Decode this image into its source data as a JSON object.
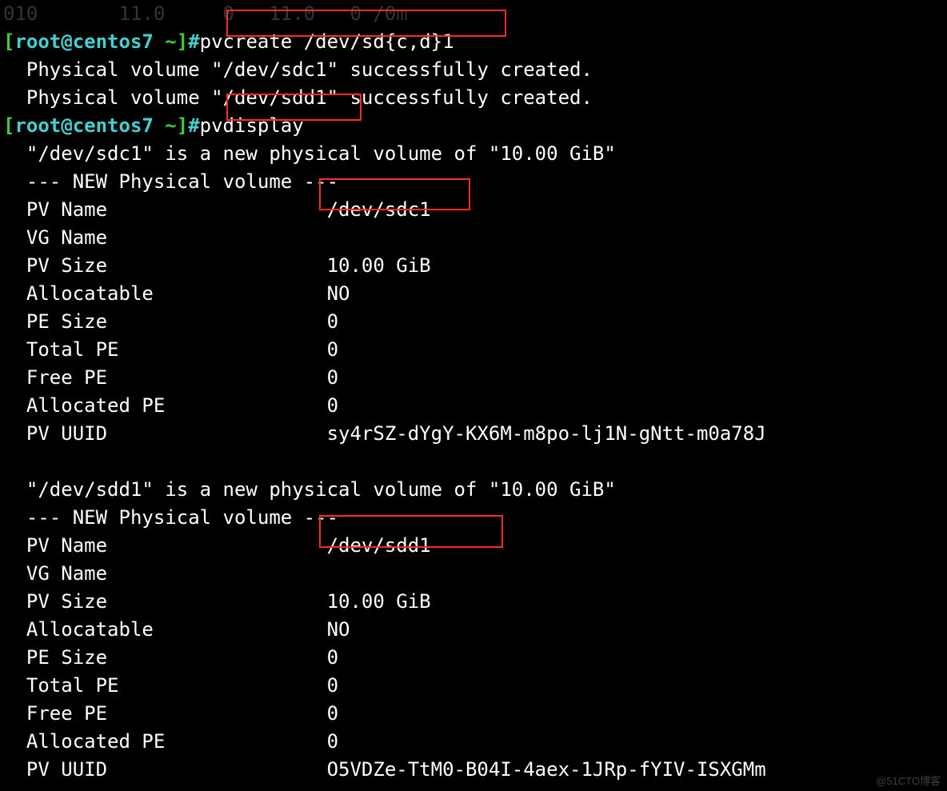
{
  "topCut": "010       11.0     0   11.0   0 /0m",
  "prompt1": {
    "user": "root",
    "host": "centos7",
    "cwd": "~",
    "cmd": "pvcreate /dev/sd{c,d}1"
  },
  "out1a": "  Physical volume \"/dev/sdc1\" successfully created.",
  "out1b": "  Physical volume \"/dev/sdd1\" successfully created.",
  "prompt2": {
    "user": "root",
    "host": "centos7",
    "cwd": "~",
    "cmd": "pvdisplay "
  },
  "pv1": {
    "intro": "  \"/dev/sdc1\" is a new physical volume of \"10.00 GiB\"",
    "hdr": "  --- NEW Physical volume ---",
    "rows": [
      {
        "k": "  PV Name",
        "v": "/dev/sdc1"
      },
      {
        "k": "  VG Name",
        "v": ""
      },
      {
        "k": "  PV Size",
        "v": "10.00 GiB"
      },
      {
        "k": "  Allocatable",
        "v": "NO"
      },
      {
        "k": "  PE Size",
        "v": "0   "
      },
      {
        "k": "  Total PE",
        "v": "0"
      },
      {
        "k": "  Free PE",
        "v": "0"
      },
      {
        "k": "  Allocated PE",
        "v": "0"
      },
      {
        "k": "  PV UUID",
        "v": "sy4rSZ-dYgY-KX6M-m8po-lj1N-gNtt-m0a78J"
      }
    ]
  },
  "blank": "   ",
  "pv2": {
    "intro": "  \"/dev/sdd1\" is a new physical volume of \"10.00 GiB\"",
    "hdr": "  --- NEW Physical volume ---",
    "rows": [
      {
        "k": "  PV Name",
        "v": "/dev/sdd1"
      },
      {
        "k": "  VG Name",
        "v": ""
      },
      {
        "k": "  PV Size",
        "v": "10.00 GiB"
      },
      {
        "k": "  Allocatable",
        "v": "NO"
      },
      {
        "k": "  PE Size",
        "v": "0   "
      },
      {
        "k": "  Total PE",
        "v": "0"
      },
      {
        "k": "  Free PE",
        "v": "0"
      },
      {
        "k": "  Allocated PE",
        "v": "0"
      },
      {
        "k": "  PV UUID",
        "v": "O5VDZe-TtM0-B04I-4aex-1JRp-fYIV-ISXGMm"
      }
    ]
  },
  "watermark": "@51CTO博客"
}
